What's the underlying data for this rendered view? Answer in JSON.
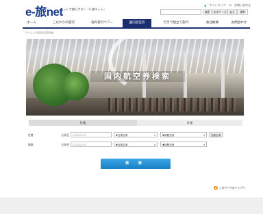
{
  "header": {
    "logo": "e-旅net",
    "tagline": "ネットで旅行プラン「e-旅ネット」",
    "top_links": [
      "サイトマップ",
      "お問い合わせ"
    ],
    "search_button": "検索",
    "font_size_label": "文字サイズ",
    "font_large": "拡大",
    "font_standard": "標準"
  },
  "nav": {
    "items": [
      {
        "label": "ホーム"
      },
      {
        "label": "こだわりの旅行"
      },
      {
        "label": "海外旅行ツアー"
      },
      {
        "label": "国内航空券"
      },
      {
        "label": "行きで組立て旅行"
      },
      {
        "label": "会社概要"
      },
      {
        "label": "お問合わせ"
      }
    ],
    "active_index": 3
  },
  "breadcrumb": "ホーム > 国内航空券検索",
  "hero": {
    "title": "国内航空券検索"
  },
  "form": {
    "tabs": [
      "往復",
      "片道"
    ],
    "rows": [
      {
        "label": "往路",
        "date_label": "出発日",
        "date_placeholder": "2015/02/17",
        "from_select": "▼出発空港",
        "to_select": "▼到着空港",
        "extra_button": "往路空港"
      },
      {
        "label": "復路",
        "date_label": "出発日",
        "date_placeholder": "2015/02/17",
        "from_select": "▼出発空港",
        "to_select": "▼到着空港"
      }
    ]
  },
  "search_button": "検 索",
  "page_top": "このページのトップへ",
  "colors": {
    "brand": "#1a3a8c",
    "nav_active": "#1a2f70",
    "search_button": "#1b7fc4",
    "page_top_icon": "#f08a1c"
  }
}
